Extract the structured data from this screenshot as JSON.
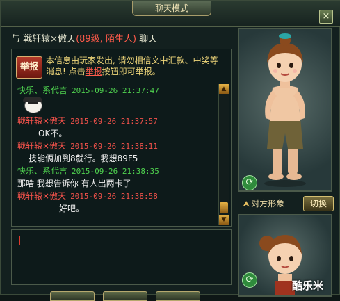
{
  "window": {
    "title": "聊天模式",
    "close_label": "×"
  },
  "chat_header": {
    "prefix": "与",
    "partner_name": "戦轩辕×傲天",
    "partner_tag": "(89级, 陌生人)",
    "suffix": "聊天"
  },
  "notice": {
    "report_label": "举报",
    "text_before": "本信息由玩家发出, 请勿相信文中汇款、中奖等消息! 点击",
    "link_text": "举报",
    "text_after": "按钮即可举报。"
  },
  "messages": [
    {
      "sender": "快乐、系代言",
      "time": "2015-09-26 21:37:47",
      "color": "green"
    },
    {
      "type": "emoji",
      "icon": "face-emoji-icon"
    },
    {
      "sender": "戦轩辕×傲天",
      "time": "2015-09-26 21:37:57",
      "color": "red"
    },
    {
      "type": "text",
      "text": "OK不。",
      "indent": 30
    },
    {
      "sender": "戦轩辕×傲天",
      "time": "2015-09-26 21:38:11",
      "color": "red"
    },
    {
      "type": "text",
      "text": "技能俩加到8就行。我想89F5",
      "indent": 16
    },
    {
      "sender": "快乐、系代言",
      "time": "2015-09-26 21:38:35",
      "color": "green"
    },
    {
      "type": "text",
      "text": "那啥 我想告诉你 有人出两卡了",
      "indent": 0
    },
    {
      "sender": "戦轩辕×傲天",
      "time": "2015-09-26 21:38:58",
      "color": "red"
    },
    {
      "type": "text",
      "text": "好吧。",
      "indent": 60
    }
  ],
  "right_panel": {
    "character_label": "对方形象",
    "switch_label": "切换"
  },
  "watermark": "酷乐米",
  "colors": {
    "accent_gold": "#e5b245",
    "sender_green": "#4fd24f",
    "sender_red": "#f0514a"
  }
}
